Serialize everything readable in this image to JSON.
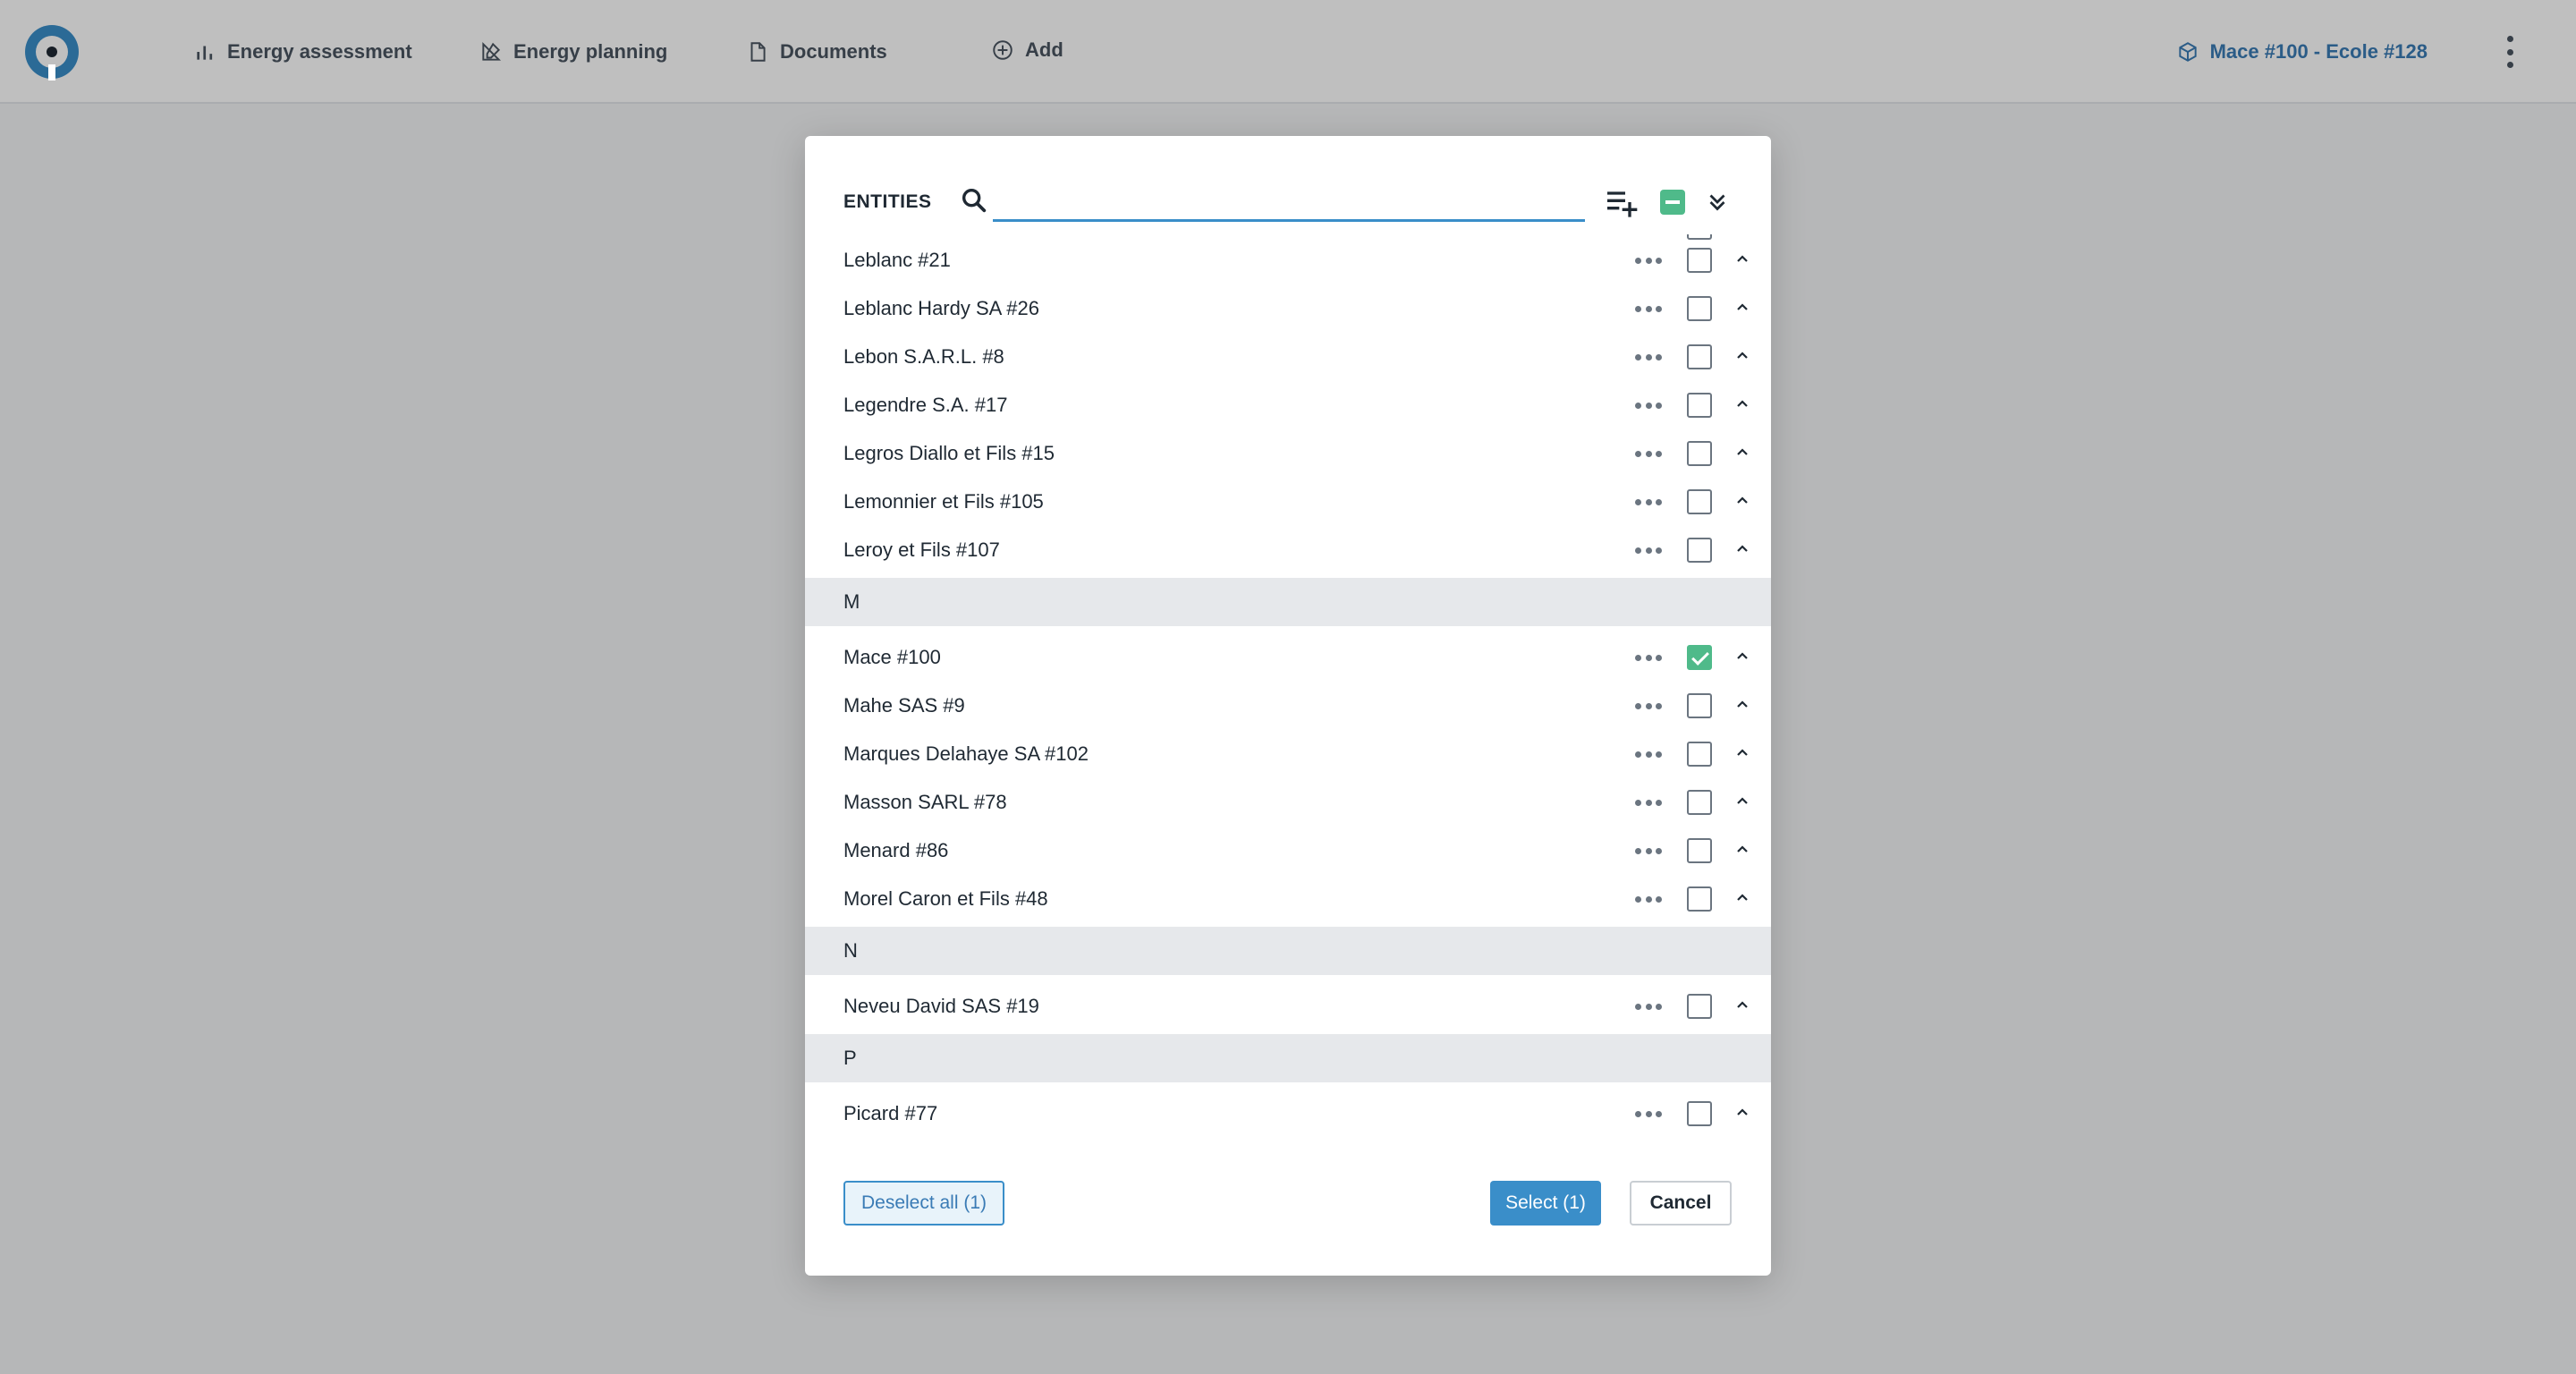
{
  "nav": {
    "items": [
      {
        "label": "Energy assessment",
        "icon": "bar-chart-icon"
      },
      {
        "label": "Energy planning",
        "icon": "pencil-ruler-icon"
      },
      {
        "label": "Documents",
        "icon": "document-icon"
      },
      {
        "label": "Add",
        "icon": "plus-circle-icon"
      }
    ],
    "project_label": "Mace #100 - Ecole #128",
    "project_icon": "cube-icon"
  },
  "modal": {
    "title": "ENTITIES",
    "search": {
      "value": "",
      "placeholder": ""
    },
    "rows": [
      {
        "type": "item",
        "label": "Leblanc #21",
        "checked": false
      },
      {
        "type": "item",
        "label": "Leblanc Hardy SA #26",
        "checked": false
      },
      {
        "type": "item",
        "label": "Lebon S.A.R.L. #8",
        "checked": false
      },
      {
        "type": "item",
        "label": "Legendre S.A. #17",
        "checked": false
      },
      {
        "type": "item",
        "label": "Legros Diallo et Fils #15",
        "checked": false
      },
      {
        "type": "item",
        "label": "Lemonnier et Fils #105",
        "checked": false
      },
      {
        "type": "item",
        "label": "Leroy et Fils #107",
        "checked": false
      },
      {
        "type": "group",
        "label": "M"
      },
      {
        "type": "item",
        "label": "Mace #100",
        "checked": true
      },
      {
        "type": "item",
        "label": "Mahe SAS #9",
        "checked": false
      },
      {
        "type": "item",
        "label": "Marques Delahaye SA #102",
        "checked": false
      },
      {
        "type": "item",
        "label": "Masson SARL #78",
        "checked": false
      },
      {
        "type": "item",
        "label": "Menard #86",
        "checked": false
      },
      {
        "type": "item",
        "label": "Morel Caron et Fils #48",
        "checked": false
      },
      {
        "type": "group",
        "label": "N"
      },
      {
        "type": "item",
        "label": "Neveu David SAS #19",
        "checked": false
      },
      {
        "type": "group",
        "label": "P"
      },
      {
        "type": "item",
        "label": "Picard #77",
        "checked": false
      }
    ],
    "footer": {
      "deselect_label": "Deselect all (1)",
      "select_label": "Select (1)",
      "cancel_label": "Cancel"
    }
  },
  "colors": {
    "accent": "#3a8ec9",
    "check_green": "#4fba8a",
    "group_bg": "#e6e8eb"
  }
}
